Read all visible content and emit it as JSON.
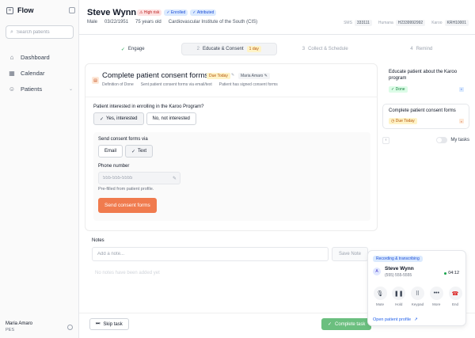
{
  "app": {
    "name": "Flow"
  },
  "sidebar": {
    "search_placeholder": "Search patients",
    "items": [
      {
        "label": "Dashboard",
        "icon": "home-icon"
      },
      {
        "label": "Calendar",
        "icon": "calendar-icon"
      },
      {
        "label": "Patients",
        "icon": "user-icon"
      }
    ],
    "user": {
      "name": "Maria Amaro",
      "role": "PES"
    }
  },
  "patient": {
    "name": "Steve Wynn",
    "badges": [
      "High risk",
      "Enrolled",
      "Attributed"
    ],
    "sex": "Male",
    "dob": "03/22/1951",
    "age": "75 years old",
    "institute": "Cardiovascular Institute of the South (CIS)",
    "ids": [
      {
        "label": "SMS",
        "value": "333111"
      },
      {
        "label": "Humana",
        "value": "H2339992992"
      },
      {
        "label": "Karoo",
        "value": "KRH10001"
      }
    ]
  },
  "stepper": {
    "steps": [
      {
        "num": "",
        "label": "Engage",
        "state": "done"
      },
      {
        "num": "2",
        "label": "Educate & Consent",
        "state": "active",
        "due": "1 day"
      },
      {
        "num": "3",
        "label": "Collect & Schedule",
        "state": "pending"
      },
      {
        "num": "4",
        "label": "Remind",
        "state": "pending"
      }
    ]
  },
  "task": {
    "title": "Complete patient consent forms",
    "due": "Due Today",
    "assignee": "Maria Amaro",
    "defs": [
      "Definition of Done",
      "Sent patient consent forms via email/text",
      "Patient has signed consent forms"
    ],
    "question": "Patient interested in enrolling in the Karoo Program?",
    "yes_label": "Yes, interested",
    "no_label": "No, not interested",
    "send_via_label": "Send consent forms via",
    "email_label": "Email",
    "text_label": "Text",
    "phone_label": "Phone number",
    "phone_placeholder": "555-555-5555",
    "prefill_note": "Pre-filled from patient profile.",
    "send_button": "Send consent forms"
  },
  "task_list": {
    "items": [
      {
        "title": "Educate patient about the Karoo program",
        "status": "Done"
      },
      {
        "title": "Complete patient consent forms",
        "status": "Due Today"
      }
    ],
    "toggle_label": "My tasks"
  },
  "notes": {
    "label": "Notes",
    "placeholder": "Add a note...",
    "save_label": "Save Note",
    "empty": "No notes have been added yet"
  },
  "footer": {
    "skip_label": "Skip task",
    "complete_label": "Complete task"
  },
  "call": {
    "status": "Recording & transcribing",
    "initial": "A",
    "name": "Steve Wynn",
    "phone": "(555) 555-5555",
    "timer": "04:12",
    "controls": [
      "Mute",
      "Hold",
      "Keypad",
      "More",
      "End"
    ],
    "open_profile": "Open patient profile"
  }
}
